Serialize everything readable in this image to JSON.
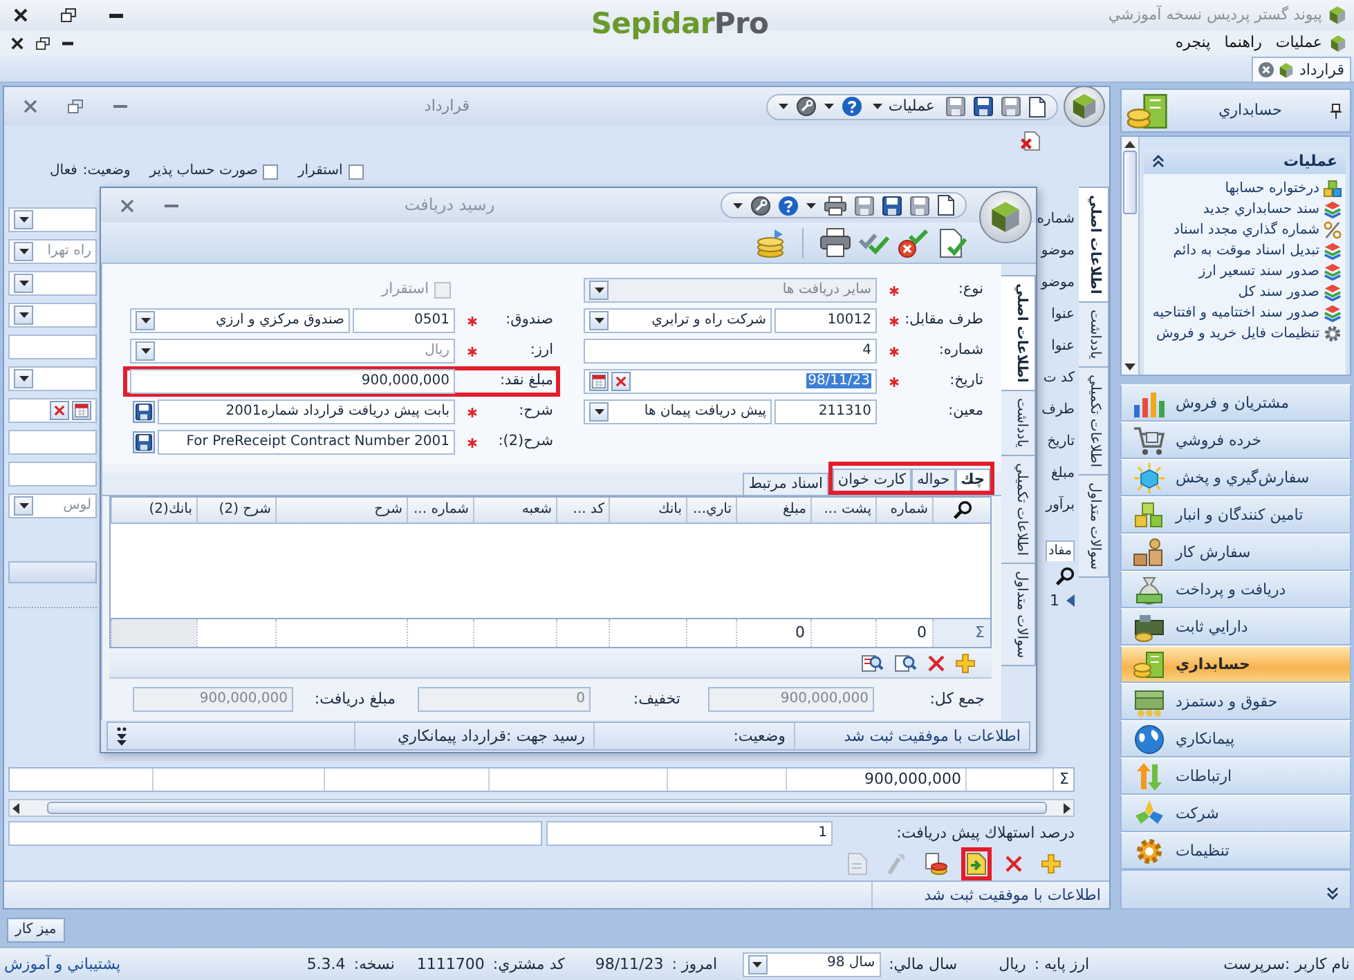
{
  "app": {
    "title": "پيوند گستر پرديس نسخه آموزشي",
    "brand": {
      "name": "Sepidar",
      "suffix": "Pro"
    }
  },
  "menu": [
    {
      "label": "عمليات"
    },
    {
      "label": "راهنما"
    },
    {
      "label": "پنجره"
    }
  ],
  "document_tabs": [
    {
      "label": "قرارداد",
      "selected": true
    }
  ],
  "contract_window": {
    "title": "قرارداد",
    "toolbar_menu": "عمليات",
    "header": {
      "checks": [
        {
          "label": "استقرار",
          "checked": false
        },
        {
          "label": "صورت حساب پذير",
          "checked": false
        }
      ],
      "status_label": "وضعيت:",
      "status_value": "فعال"
    },
    "side_tabs": [
      {
        "label": "اطلاعات اصلي",
        "selected": true
      },
      {
        "label": "يادداشت",
        "selected": false
      },
      {
        "label": "اطلاعات تكميلي",
        "selected": false
      },
      {
        "label": "سوالات متداول",
        "selected": false
      }
    ],
    "field_labels": [
      "شماره",
      "موضو",
      "موضو",
      "عنوا",
      "عنوا",
      "كد ت",
      "طرف",
      "تاريخ",
      "مبلغ",
      "برآور"
    ],
    "left_fields": [
      {
        "kind": "combo"
      },
      {
        "kind": "combo",
        "value": "راه تهرا"
      },
      {
        "kind": "combo"
      },
      {
        "kind": "combo"
      },
      {
        "kind": "text"
      },
      {
        "kind": "combo"
      },
      {
        "kind": "date"
      },
      {
        "kind": "text"
      },
      {
        "kind": "text"
      },
      {
        "kind": "combo",
        "value": "لوس"
      }
    ],
    "detail_tab": "مفاد",
    "row_number": "1",
    "totals_symbol": "Σ",
    "total_amount": "900,000,000",
    "prepayment": {
      "label": "درصد استهلاك پيش دريافت:",
      "value": "1"
    },
    "toolbar": [
      {
        "kind": "add",
        "disabled": false,
        "highlighted": false
      },
      {
        "kind": "delete",
        "disabled": false,
        "highlighted": false
      },
      {
        "kind": "document",
        "disabled": false,
        "highlighted": true
      },
      {
        "kind": "coins",
        "disabled": false,
        "highlighted": false
      },
      {
        "kind": "tool",
        "disabled": true,
        "highlighted": false
      },
      {
        "kind": "page",
        "disabled": true,
        "highlighted": false
      }
    ],
    "status": "اطلاعات با موفقيت ثبت شد"
  },
  "receipt_dialog": {
    "title": "رسيد دريافت",
    "side_tabs": [
      {
        "label": "اطلاعات اصلي",
        "selected": true
      },
      {
        "label": "يادداشت",
        "selected": false
      },
      {
        "label": "اطلاعات تكميلي",
        "selected": false
      },
      {
        "label": "سوالات متداول",
        "selected": false
      }
    ],
    "form_right": [
      {
        "kind": "combo",
        "label": "نوع:",
        "required": true,
        "value": "ساير دريافت ها",
        "disabled": true,
        "highlighted": false
      },
      {
        "kind": "code_combo",
        "label": "طرف مقابل:",
        "required": true,
        "code": "10012",
        "value": "شركت راه و ترابري",
        "highlighted": false
      },
      {
        "kind": "text",
        "label": "شماره:",
        "required": true,
        "value": "4",
        "highlighted": false
      },
      {
        "kind": "date",
        "label": "تاريخ:",
        "required": true,
        "value": "98/11/23",
        "selected": true,
        "highlighted": false
      },
      {
        "kind": "code_combo",
        "label": "معين:",
        "required": false,
        "code": "211310",
        "value": "پيش دريافت پيمان ها",
        "highlighted": false
      }
    ],
    "form_left": [
      {
        "kind": "checkbox",
        "label": "استقرار",
        "checked": false,
        "disabled": true,
        "highlighted": false
      },
      {
        "kind": "code_combo",
        "label": "صندوق:",
        "required": true,
        "code": "0501",
        "value": "صندوق مركزي و ارزي",
        "highlighted": false
      },
      {
        "kind": "combo",
        "label": "ارز:",
        "required": true,
        "value": "ريال",
        "muted": true,
        "highlighted": false
      },
      {
        "kind": "text",
        "label": "مبلغ نقد:",
        "required": false,
        "value": "900,000,000",
        "highlighted": true
      },
      {
        "kind": "memo",
        "label": "شرح:",
        "required": true,
        "value": "بابت پيش دريافت قرارداد شماره2001",
        "highlighted": false
      },
      {
        "kind": "memo",
        "label": "شرح(2):",
        "required": true,
        "value": "For PreReceipt Contract Number 2001",
        "highlighted": false
      }
    ],
    "tabs": [
      {
        "label": "چك",
        "selected": true,
        "highlighted": true
      },
      {
        "label": "حواله",
        "selected": false,
        "highlighted": true
      },
      {
        "label": "كارت خوان",
        "selected": false,
        "highlighted": true
      },
      {
        "label": "اسناد مرتبط",
        "selected": false,
        "highlighted": false
      }
    ],
    "grid": {
      "totals_symbol": "Σ",
      "columns": [
        {
          "title": "شماره",
          "total": "0"
        },
        {
          "title": "پشت ..."
        },
        {
          "title": "مبلغ",
          "total": "0"
        },
        {
          "title": "تاري..."
        },
        {
          "title": "بانك"
        },
        {
          "title": "كد ..."
        },
        {
          "title": "شعبه"
        },
        {
          "title": "شماره ..."
        },
        {
          "title": "شرح"
        },
        {
          "title": "شرح (2)"
        },
        {
          "title": "بانك(2)"
        }
      ]
    },
    "grid_toolbar": [
      {
        "kind": "add"
      },
      {
        "kind": "delete"
      },
      {
        "kind": "find"
      },
      {
        "kind": "replace"
      }
    ],
    "summary": [
      {
        "label": "جمع كل:",
        "value": "900,000,000",
        "disabled": true
      },
      {
        "label": "تخفيف:",
        "value": "0",
        "disabled": true
      },
      {
        "label": "مبلغ دريافت:",
        "value": "900,000,000",
        "disabled": true
      }
    ],
    "status": {
      "message": "اطلاعات با موفقيت ثبت شد",
      "state_label": "وضعيت:",
      "purpose": "رسيد جهت :قرارداد پيمانكاري"
    }
  },
  "sidebar": {
    "title": "حسابداري",
    "task_group": {
      "title": "عمليات",
      "expanded": true,
      "items": [
        "درختواره حسابها",
        "سند حسابداري جديد",
        "شماره گذاري مجدد اسناد",
        "تبديل اسناد موقت به دائم",
        "صدور سند تسعير ارز",
        "صدور سند كل",
        "صدور سند اختتاميه و افتتاحيه",
        "تنظيمات فايل خريد و فروش"
      ]
    },
    "modules": [
      {
        "label": "مشتريان و فروش",
        "selected": false
      },
      {
        "label": "خرده فروشي",
        "selected": false
      },
      {
        "label": "سفارش‌گيري و پخش",
        "selected": false
      },
      {
        "label": "تامين كنندگان و انبار",
        "selected": false
      },
      {
        "label": "سفارش كار",
        "selected": false
      },
      {
        "label": "دريافت و پرداخت",
        "selected": false
      },
      {
        "label": "دارايي ثابت",
        "selected": false
      },
      {
        "label": "حسابداري",
        "selected": true
      },
      {
        "label": "حقوق و دستمزد",
        "selected": false
      },
      {
        "label": "پيمانكاري",
        "selected": false
      },
      {
        "label": "ارتباطات",
        "selected": false
      },
      {
        "label": "شركت",
        "selected": false
      },
      {
        "label": "تنظيمات",
        "selected": false
      }
    ]
  },
  "desk_button": "ميز كار",
  "status_bar": {
    "items": [
      {
        "kind": "text",
        "label": "نام كاربر :سرپرست"
      },
      {
        "kind": "text",
        "label": "ارز پايه :",
        "value": "ريال"
      },
      {
        "kind": "combo",
        "label": "سال مالي:",
        "value": "سال 98"
      },
      {
        "kind": "text",
        "label": "امروز :",
        "value": "98/11/23"
      },
      {
        "kind": "text",
        "label": "كد مشتري:",
        "value": "1111700"
      },
      {
        "kind": "text",
        "label": "نسخه:",
        "value": "5.3.4"
      }
    ],
    "support_link": "پشتيباني و آموزش"
  }
}
